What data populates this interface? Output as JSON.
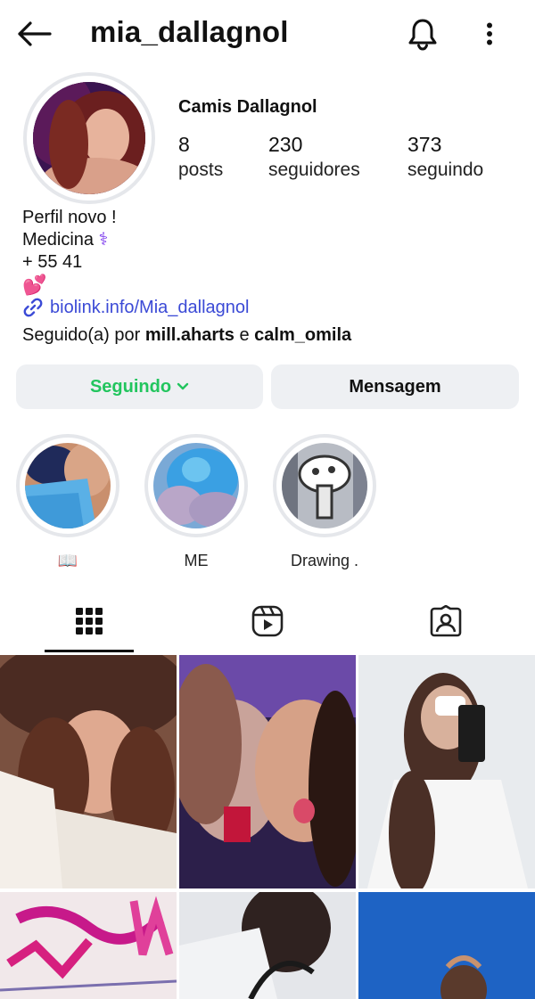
{
  "header": {
    "username": "mia_dallagnol",
    "back_icon": "arrow-left-icon",
    "bell_icon": "bell-icon",
    "menu_icon": "more-vertical-icon"
  },
  "profile": {
    "display_name": "Camis Dallagnol",
    "stats": [
      {
        "value": "8",
        "label": "posts"
      },
      {
        "value": "230",
        "label": "seguidores"
      },
      {
        "value": "373",
        "label": "seguindo"
      }
    ],
    "bio": {
      "line1": "Perfil novo !",
      "line2": "Medicina",
      "line2_emoji": "⚕",
      "line3": "+ 55 41",
      "line4_emoji": "💕"
    },
    "link": {
      "icon": "link-icon",
      "text": "biolink.info/Mia_dallagnol"
    },
    "followed_by": {
      "prefix": "Seguido(a) por",
      "user1": "mill.aharts",
      "connector": "e",
      "user2": "calm_omila"
    }
  },
  "actions": {
    "following_label": "Seguindo",
    "following_chevron": "chevron-down-icon",
    "message_label": "Mensagem"
  },
  "highlights": [
    {
      "label": "📖"
    },
    {
      "label": "ME"
    },
    {
      "label": "Drawing ."
    }
  ],
  "tabs": [
    {
      "icon": "grid-icon",
      "active": true
    },
    {
      "icon": "reels-icon",
      "active": false
    },
    {
      "icon": "tagged-icon",
      "active": false
    }
  ],
  "colors": {
    "following_green": "#22c55e",
    "link_blue": "#3b4ad6",
    "button_gray": "#eef0f3"
  }
}
